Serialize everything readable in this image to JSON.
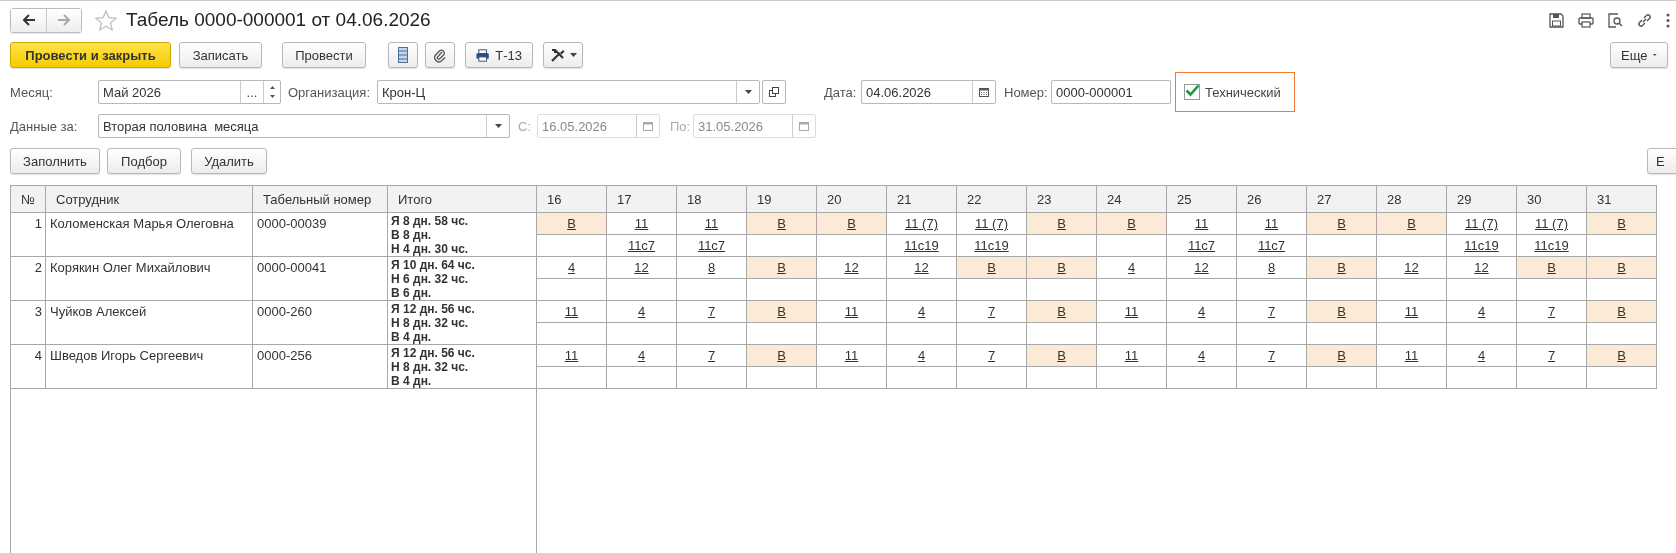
{
  "window": {
    "title": "Табель 0000-000001 от 04.06.2026"
  },
  "toolbar": {
    "primary": "Провести и закрыть",
    "buttons": [
      "Записать",
      "Провести"
    ],
    "print_button": "Т-13",
    "more": "Еще"
  },
  "form": {
    "month": {
      "label": "Месяц:",
      "value": "Май 2026",
      "choose": "..."
    },
    "organization": {
      "label": "Организация:",
      "value": "Крон-Ц"
    },
    "date": {
      "label": "Дата:",
      "value": "04.06.2026"
    },
    "number": {
      "label": "Номер:",
      "value": "0000-000001"
    },
    "technical": {
      "label": "Технический",
      "checked": true
    },
    "period": {
      "label": "Данные за:",
      "value": "Вторая половина  месяца"
    },
    "from": {
      "label": "С:",
      "value": "16.05.2026",
      "disabled": true
    },
    "to": {
      "label": "По:",
      "value": "31.05.2026",
      "disabled": true
    }
  },
  "table_buttons": [
    "Заполнить",
    "Подбор",
    "Удалить"
  ],
  "table_more": "Е",
  "table": {
    "columns": [
      "№",
      "Сотрудник",
      "Табельный номер",
      "Итого"
    ],
    "days": [
      "16",
      "17",
      "18",
      "19",
      "20",
      "21",
      "22",
      "23",
      "24",
      "25",
      "26",
      "27",
      "28",
      "29",
      "30",
      "31"
    ],
    "rows": [
      {
        "n": "1",
        "employee": "Коломенская Марья Олеговна",
        "tab_number": "0000-00039",
        "totals": [
          "Я 8 дн. 58 чс.",
          "В 8 дн.",
          "Н 4 дн. 30 чс."
        ],
        "days": [
          {
            "value": "В",
            "weekend": true
          },
          {
            "value": "11",
            "detail": "11с7",
            "weekend": false
          },
          {
            "value": "11",
            "detail": "11с7",
            "weekend": false
          },
          {
            "value": "В",
            "weekend": true
          },
          {
            "value": "В",
            "weekend": true
          },
          {
            "value": "11 (7)",
            "detail": "11с19",
            "weekend": false
          },
          {
            "value": "11 (7)",
            "detail": "11с19",
            "weekend": false
          },
          {
            "value": "В",
            "weekend": true
          },
          {
            "value": "В",
            "weekend": true
          },
          {
            "value": "11",
            "detail": "11с7",
            "weekend": false
          },
          {
            "value": "11",
            "detail": "11с7",
            "weekend": false
          },
          {
            "value": "В",
            "weekend": true
          },
          {
            "value": "В",
            "weekend": true
          },
          {
            "value": "11 (7)",
            "detail": "11с19",
            "weekend": false
          },
          {
            "value": "11 (7)",
            "detail": "11с19",
            "weekend": false
          },
          {
            "value": "В",
            "weekend": true
          }
        ]
      },
      {
        "n": "2",
        "employee": "Корякин Олег Михайлович",
        "tab_number": "0000-00041",
        "totals": [
          "Я 10 дн. 64 чс.",
          "Н 6 дн. 32 чс.",
          "В 6 дн."
        ],
        "days": [
          {
            "value": "4",
            "weekend": false
          },
          {
            "value": "12",
            "weekend": false
          },
          {
            "value": "8",
            "weekend": false
          },
          {
            "value": "В",
            "weekend": true
          },
          {
            "value": "12",
            "weekend": false
          },
          {
            "value": "12",
            "weekend": false
          },
          {
            "value": "В",
            "weekend": true
          },
          {
            "value": "В",
            "weekend": true
          },
          {
            "value": "4",
            "weekend": false
          },
          {
            "value": "12",
            "weekend": false
          },
          {
            "value": "8",
            "weekend": false
          },
          {
            "value": "В",
            "weekend": true
          },
          {
            "value": "12",
            "weekend": false
          },
          {
            "value": "12",
            "weekend": false
          },
          {
            "value": "В",
            "weekend": true
          },
          {
            "value": "В",
            "weekend": true
          }
        ]
      },
      {
        "n": "3",
        "employee": "Чуйков Алексей",
        "tab_number": "0000-260",
        "totals": [
          "Я 12 дн. 56 чс.",
          "Н 8 дн. 32 чс.",
          "В 4 дн."
        ],
        "days": [
          {
            "value": "11",
            "weekend": false
          },
          {
            "value": "4",
            "weekend": false
          },
          {
            "value": "7",
            "weekend": false
          },
          {
            "value": "В",
            "weekend": true
          },
          {
            "value": "11",
            "weekend": false
          },
          {
            "value": "4",
            "weekend": false
          },
          {
            "value": "7",
            "weekend": false
          },
          {
            "value": "В",
            "weekend": true
          },
          {
            "value": "11",
            "weekend": false
          },
          {
            "value": "4",
            "weekend": false
          },
          {
            "value": "7",
            "weekend": false
          },
          {
            "value": "В",
            "weekend": true
          },
          {
            "value": "11",
            "weekend": false
          },
          {
            "value": "4",
            "weekend": false
          },
          {
            "value": "7",
            "weekend": false
          },
          {
            "value": "В",
            "weekend": true
          }
        ]
      },
      {
        "n": "4",
        "employee": "Шведов Игорь Сергеевич",
        "tab_number": "0000-256",
        "totals": [
          "Я 12 дн. 56 чс.",
          "Н 8 дн. 32 чс.",
          "В 4 дн."
        ],
        "days": [
          {
            "value": "11",
            "weekend": false
          },
          {
            "value": "4",
            "weekend": false
          },
          {
            "value": "7",
            "weekend": false
          },
          {
            "value": "В",
            "weekend": true
          },
          {
            "value": "11",
            "weekend": false
          },
          {
            "value": "4",
            "weekend": false
          },
          {
            "value": "7",
            "weekend": false
          },
          {
            "value": "В",
            "weekend": true
          },
          {
            "value": "11",
            "weekend": false
          },
          {
            "value": "4",
            "weekend": false
          },
          {
            "value": "7",
            "weekend": false
          },
          {
            "value": "В",
            "weekend": true
          },
          {
            "value": "11",
            "weekend": false
          },
          {
            "value": "4",
            "weekend": false
          },
          {
            "value": "7",
            "weekend": false
          },
          {
            "value": "В",
            "weekend": true
          }
        ]
      }
    ]
  }
}
